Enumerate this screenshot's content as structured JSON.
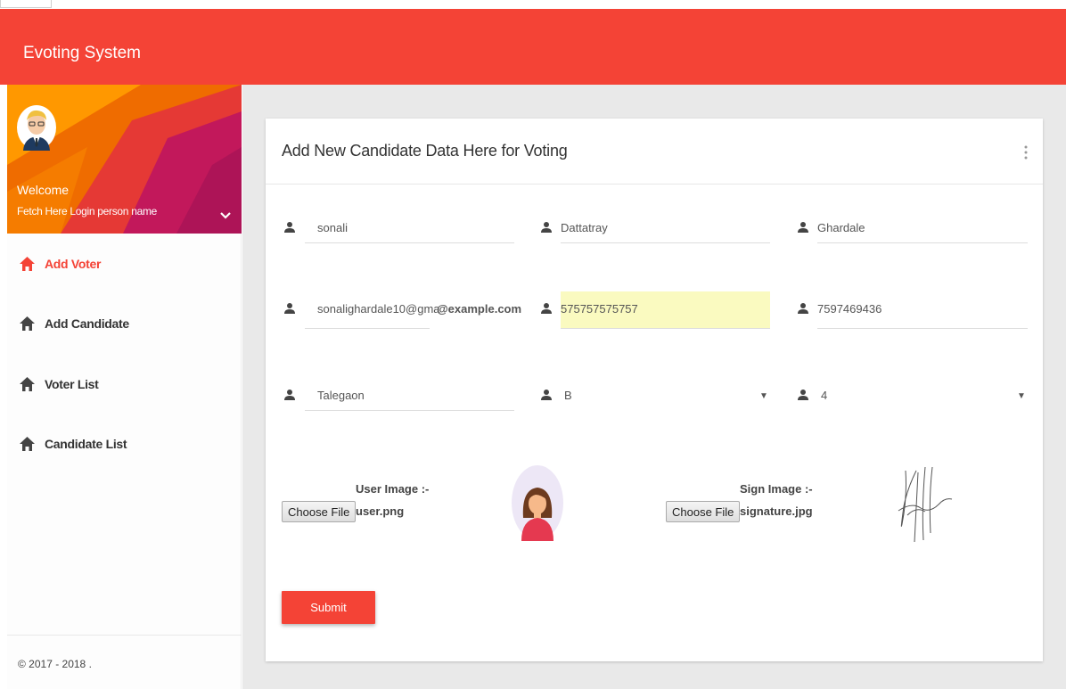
{
  "app": {
    "title": "Evoting System"
  },
  "sidebar": {
    "welcome": "Welcome",
    "login_name": "Fetch Here Login person name",
    "items": [
      {
        "label": "Add Voter",
        "icon": "home-icon",
        "active": true
      },
      {
        "label": "Add Candidate",
        "icon": "home-icon",
        "active": false
      },
      {
        "label": "Voter List",
        "icon": "home-icon",
        "active": false
      },
      {
        "label": "Candidate List",
        "icon": "home-icon",
        "active": false
      }
    ],
    "footer": "© 2017 - 2018 ."
  },
  "form": {
    "title": "Add New Candidate Data Here for Voting",
    "first_name": "sonali",
    "middle_name": "Dattatray",
    "last_name": "Ghardale",
    "email": "sonalighardale10@gma",
    "email_suffix": "@example.com",
    "aadhaar": "575757575757",
    "mobile": "7597469436",
    "city": "Talegaon",
    "section": "B",
    "ward": "4",
    "user_image_label": "User Image :-",
    "user_image_file": "user.png",
    "sign_image_label": "Sign Image :-",
    "sign_image_file": "signature.jpg",
    "choose_file": "Choose File",
    "submit": "Submit"
  },
  "colors": {
    "accent": "#f44336",
    "highlight": "#fafac0"
  }
}
